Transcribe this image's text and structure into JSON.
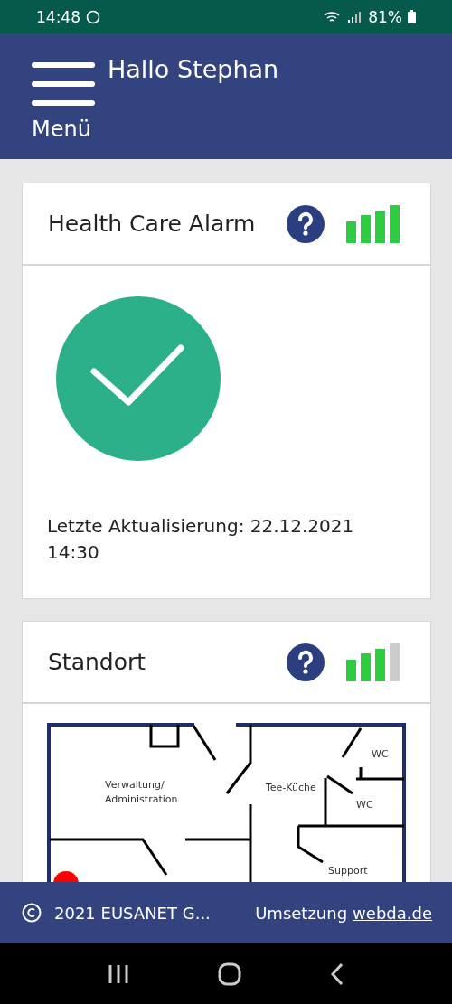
{
  "status_bar": {
    "time": "14:48",
    "battery": "81%"
  },
  "header": {
    "menu_label": "Menü",
    "greeting": "Hallo Stephan"
  },
  "cards": [
    {
      "kind": "status",
      "title": "Health Care Alarm",
      "signal_bars": [
        {
          "on": true
        },
        {
          "on": true
        },
        {
          "on": true
        },
        {
          "on": true
        }
      ],
      "ok": true,
      "updated": "Letzte Aktualisierung: 22.12.2021 14:30"
    },
    {
      "kind": "floorplan",
      "title": "Standort",
      "signal_bars": [
        {
          "on": true
        },
        {
          "on": true
        },
        {
          "on": true
        },
        {
          "on": false
        }
      ],
      "rooms": [
        {
          "label": "Verwaltung/"
        },
        {
          "label": "Administration"
        },
        {
          "label": "Tee-Küche"
        },
        {
          "label": "WC"
        },
        {
          "label": "WC"
        },
        {
          "label": "Support"
        }
      ]
    }
  ],
  "footer": {
    "copyright": "2021 EUSANET G...",
    "credit": "Umsetzung",
    "link": "webda.de"
  }
}
